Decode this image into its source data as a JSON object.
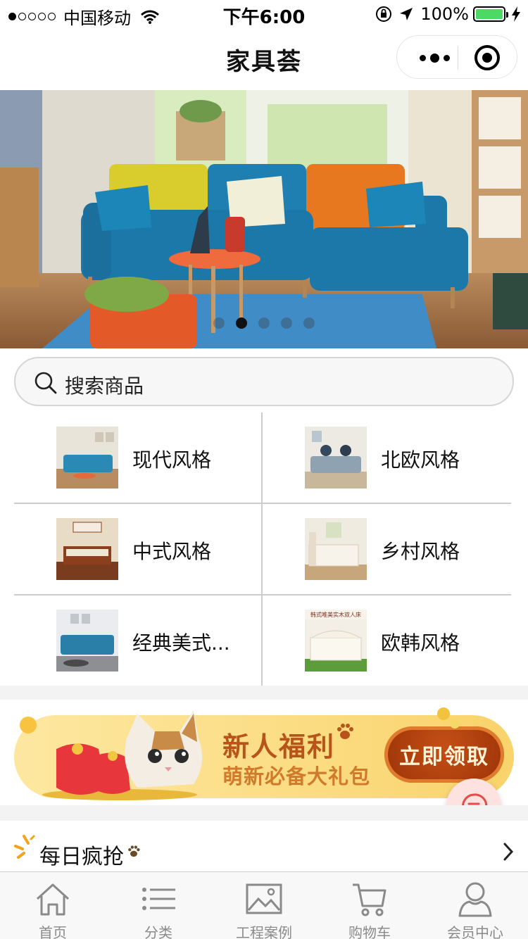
{
  "status_bar": {
    "carrier": "中国移动",
    "time": "下午6:00",
    "battery": "100%"
  },
  "nav": {
    "title": "家具荟"
  },
  "banner": {
    "slide_count": 5,
    "active_slide": 2
  },
  "search": {
    "placeholder": "搜索商品"
  },
  "categories": [
    {
      "label": "现代风格"
    },
    {
      "label": "北欧风格"
    },
    {
      "label": "中式风格"
    },
    {
      "label": "乡村风格"
    },
    {
      "label": "经典美式..."
    },
    {
      "label": "欧韩风格"
    }
  ],
  "promo": {
    "title": "新人福利",
    "subtitle": "萌新必备大礼包",
    "button": "立即领取",
    "overlay_text": "韩式唯美实木双人床"
  },
  "daily": {
    "title": "每日疯抢"
  },
  "tabs": [
    {
      "label": "首页",
      "icon": "home-icon"
    },
    {
      "label": "分类",
      "icon": "list-icon"
    },
    {
      "label": "工程案例",
      "icon": "image-icon"
    },
    {
      "label": "购物车",
      "icon": "cart-icon"
    },
    {
      "label": "会员中心",
      "icon": "user-icon"
    }
  ],
  "colors": {
    "promo_title": "#b8541a",
    "promo_button": "#a93a0b",
    "battery": "#4cd964",
    "tab_label": "#8a8a8a"
  }
}
